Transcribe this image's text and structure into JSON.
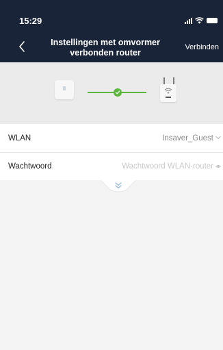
{
  "status_bar": {
    "time": "15:29"
  },
  "header": {
    "title": "Instellingen met omvormer verbonden router",
    "connect_label": "Verbinden"
  },
  "form": {
    "rows": [
      {
        "label": "WLAN",
        "value": "Insaver_Guest"
      },
      {
        "label": "Wachtwoord",
        "placeholder": "Wachtwoord WLAN-router"
      }
    ]
  },
  "colors": {
    "header_bg": "#1a2438",
    "accent_green": "#5cb63c",
    "page_bg": "#f4f4f4"
  },
  "icons": {
    "back": "chevron-left-icon",
    "connection": "check-circle-icon",
    "expand": "double-chevron-down-icon"
  }
}
